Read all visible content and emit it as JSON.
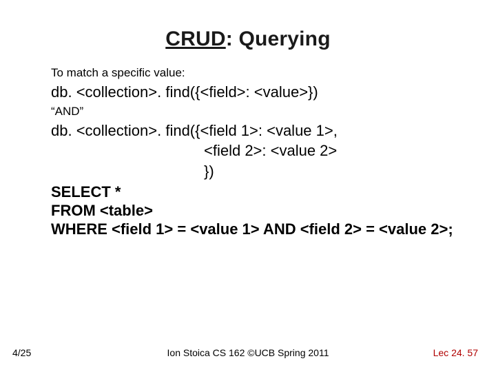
{
  "title_prefix": "CRUD",
  "title_suffix": ": Querying",
  "label_match": "To match a specific value:",
  "code_find_single": "db. <collection>. find({<field>: <value>})",
  "label_and": "“AND”",
  "code_find_and_line1": "db. <collection>. find({<field 1>: <value 1>,",
  "code_find_and_line2": "<field 2>: <value 2>",
  "code_find_and_line3": "})",
  "sql_line1": "SELECT *",
  "sql_line2": "FROM <table>",
  "sql_line3": "WHERE <field 1> = <value 1> AND <field 2> = <value 2>;",
  "footer": {
    "left": "4/25",
    "center": "Ion Stoica CS 162 ©UCB Spring 2011",
    "right": "Lec 24. 57"
  }
}
